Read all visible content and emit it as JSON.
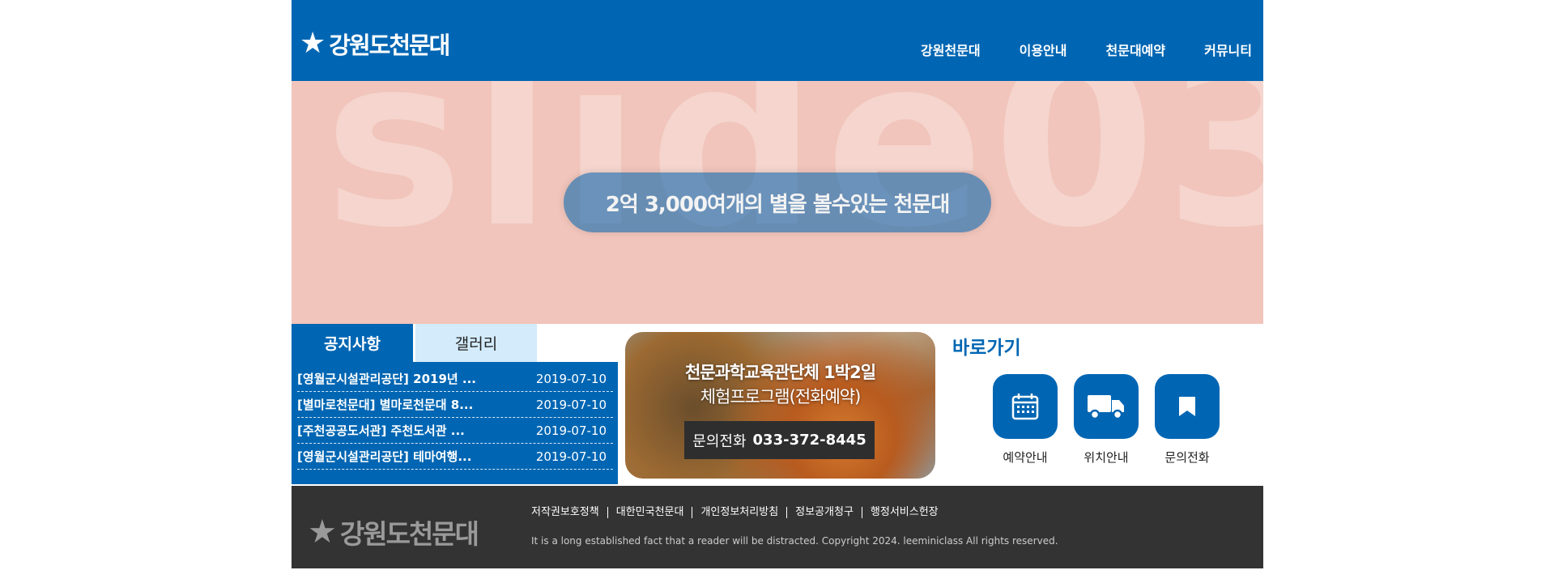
{
  "header": {
    "logo_text": "강원도천문대",
    "nav": [
      "강원천문대",
      "이용안내",
      "천문대예약",
      "커뮤니티"
    ]
  },
  "slider": {
    "watermark": "slide03",
    "caption": "2억 3,000여개의 별을 볼수있는 천문대"
  },
  "notice": {
    "tabs": [
      "공지사항",
      "갤러리"
    ],
    "items": [
      {
        "title": "[영월군시설관리공단] 2019년 ...",
        "date": "2019-07-10"
      },
      {
        "title": "[별마로천문대] 별마로천문대 8...",
        "date": "2019-07-10"
      },
      {
        "title": "[주천공공도서관] 주천도서관 ...",
        "date": "2019-07-10"
      },
      {
        "title": "[영월군시설관리공단] 테마여행...",
        "date": "2019-07-10"
      }
    ]
  },
  "banner": {
    "title": "천문과학교육관단체 1박2일",
    "subtitle": "체험프로그램(전화예약)",
    "phone_label": "문의전화",
    "phone_number": "033-372-8445"
  },
  "shortcuts": {
    "title": "바로가기",
    "items": [
      {
        "label": "예약안내",
        "icon": "calendar-icon"
      },
      {
        "label": "위치안내",
        "icon": "truck-icon"
      },
      {
        "label": "문의전화",
        "icon": "bookmark-icon"
      }
    ]
  },
  "footer": {
    "logo_text": "강원도천문대",
    "links": [
      "저작권보호정책",
      "대한민국천문대",
      "개인정보처리방침",
      "정보공개청구",
      "행정서비스헌장"
    ],
    "copyright": "It is a long established fact that a reader will be distracted. Copyright 2024. leeminiclass All rights reserved."
  },
  "colors": {
    "primary": "#0066b3",
    "slider_bg": "#f1c5bb",
    "tab_inactive": "#d3ebfb",
    "footer_bg": "#333333"
  }
}
